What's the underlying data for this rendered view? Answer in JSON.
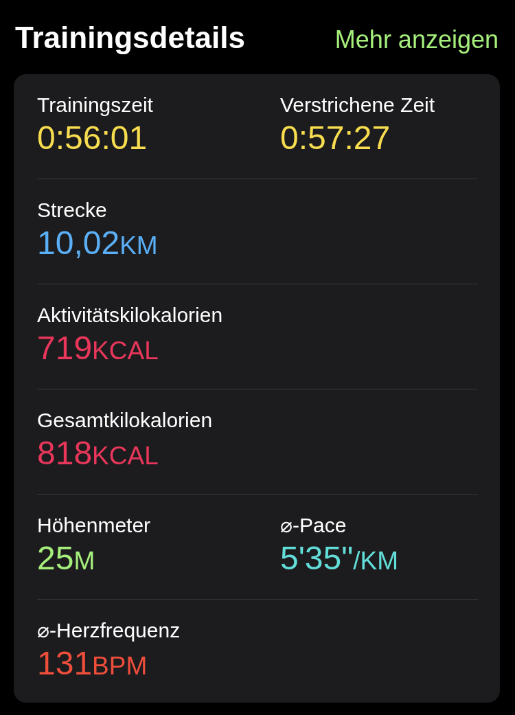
{
  "header": {
    "title": "Trainingsdetails",
    "link": "Mehr anzeigen"
  },
  "rows": [
    {
      "metrics": [
        {
          "label": "Trainingszeit",
          "value": "0:56:01",
          "color": "#f7dd4f"
        },
        {
          "label": "Verstrichene Zeit",
          "value": "0:57:27",
          "color": "#f7dd4f"
        }
      ]
    },
    {
      "metrics": [
        {
          "label": "Strecke",
          "value": "10,02",
          "unit": "KM",
          "color": "#5aaff6"
        }
      ]
    },
    {
      "metrics": [
        {
          "label": "Aktivitätskilokalorien",
          "value": "719",
          "unit": "KCAL",
          "color": "#e8375b"
        }
      ]
    },
    {
      "metrics": [
        {
          "label": "Gesamtkilokalorien",
          "value": "818",
          "unit": "KCAL",
          "color": "#e8375b"
        }
      ]
    },
    {
      "metrics": [
        {
          "label": "Höhenmeter",
          "value": "25",
          "unit": "M",
          "color": "#a6ef7c"
        },
        {
          "label": "⌀-Pace",
          "value": "5'35\"",
          "unit": "/KM",
          "color": "#62ddd8"
        }
      ]
    },
    {
      "metrics": [
        {
          "label": "⌀-Herzfrequenz",
          "value": "131",
          "unit": "BPM",
          "color": "#ef4e3b"
        }
      ]
    }
  ]
}
